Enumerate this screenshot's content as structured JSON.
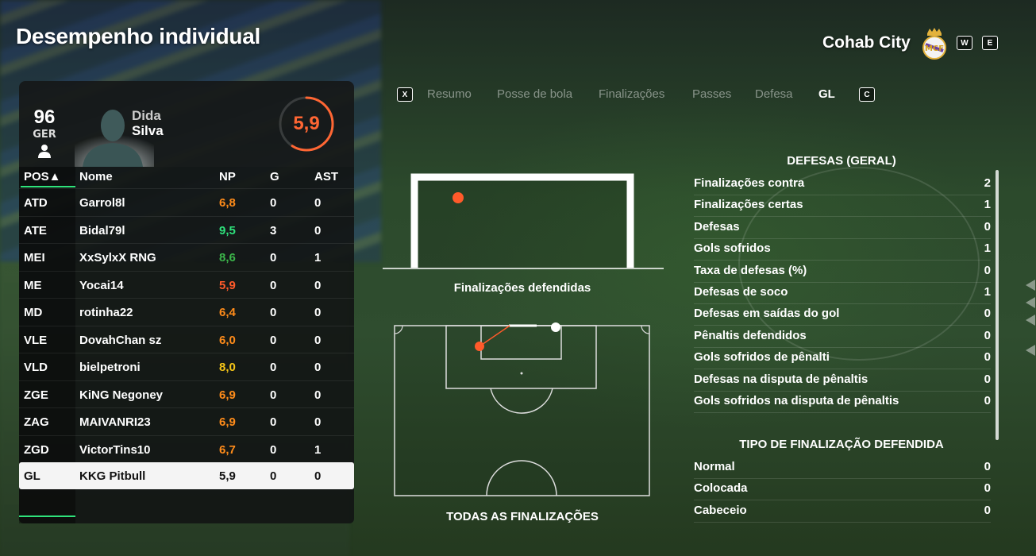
{
  "header": {
    "title": "Desempenho individual",
    "team_name": "Cohab City",
    "key_prev": "W",
    "key_next": "E"
  },
  "player": {
    "overall": "96",
    "position": "GER",
    "first_name": "Dida",
    "last_name": "Silva",
    "rating": "5,9",
    "rating_color": "#ff6633"
  },
  "table": {
    "headers": {
      "pos": "POS▲",
      "name": "Nome",
      "np": "NP",
      "g": "G",
      "ast": "AST"
    },
    "rows": [
      {
        "pos": "ATD",
        "name": "Garrol8l",
        "np": "6,8",
        "np_color": "#ff8c1a",
        "g": "0",
        "ast": "0"
      },
      {
        "pos": "ATE",
        "name": "Bidal79l",
        "np": "9,5",
        "np_color": "#2fe27b",
        "g": "3",
        "ast": "0"
      },
      {
        "pos": "MEI",
        "name": "XxSylxX RNG",
        "np": "8,6",
        "np_color": "#3cb54a",
        "g": "0",
        "ast": "1"
      },
      {
        "pos": "ME",
        "name": "Yocai14",
        "np": "5,9",
        "np_color": "#ff5a2a",
        "g": "0",
        "ast": "0"
      },
      {
        "pos": "MD",
        "name": "rotinha22",
        "np": "6,4",
        "np_color": "#ff8c1a",
        "g": "0",
        "ast": "0"
      },
      {
        "pos": "VLE",
        "name": "DovahChan sz",
        "np": "6,0",
        "np_color": "#ff8c1a",
        "g": "0",
        "ast": "0"
      },
      {
        "pos": "VLD",
        "name": "bielpetroni",
        "np": "8,0",
        "np_color": "#f5c518",
        "g": "0",
        "ast": "0"
      },
      {
        "pos": "ZGE",
        "name": "KiNG Negoney",
        "np": "6,9",
        "np_color": "#ff8c1a",
        "g": "0",
        "ast": "0"
      },
      {
        "pos": "ZAG",
        "name": "MAIVANRI23",
        "np": "6,9",
        "np_color": "#ff8c1a",
        "g": "0",
        "ast": "0"
      },
      {
        "pos": "ZGD",
        "name": "VictorTins10",
        "np": "6,7",
        "np_color": "#ff8c1a",
        "g": "0",
        "ast": "1"
      },
      {
        "pos": "GL",
        "name": "KKG Pitbull",
        "np": "5,9",
        "np_color": "#111111",
        "g": "0",
        "ast": "0"
      }
    ]
  },
  "tabs": {
    "key_left": "X",
    "key_right": "C",
    "items": [
      "Resumo",
      "Posse de bola",
      "Finalizações",
      "Passes",
      "Defesa",
      "GL"
    ],
    "active": "GL"
  },
  "goal_graphic": {
    "label_saved": "Finalizações defendidas",
    "label_all": "TODAS AS FINALIZAÇÕES"
  },
  "stats": {
    "section1_title": "DEFESAS (GERAL)",
    "section1": [
      {
        "label": "Finalizações contra",
        "value": "2"
      },
      {
        "label": "Finalizações certas",
        "value": "1"
      },
      {
        "label": "Defesas",
        "value": "0"
      },
      {
        "label": "Gols sofridos",
        "value": "1"
      },
      {
        "label": "Taxa de defesas (%)",
        "value": "0"
      },
      {
        "label": "Defesas de soco",
        "value": "1"
      },
      {
        "label": "Defesas em saídas do gol",
        "value": "0"
      },
      {
        "label": "Pênaltis defendidos",
        "value": "0"
      },
      {
        "label": "Gols sofridos de pênalti",
        "value": "0"
      },
      {
        "label": "Defesas na disputa de pênaltis",
        "value": "0"
      },
      {
        "label": "Gols sofridos na disputa de pênaltis",
        "value": "0"
      }
    ],
    "section2_title": "TIPO DE FINALIZAÇÃO DEFENDIDA",
    "section2": [
      {
        "label": "Normal",
        "value": "0"
      },
      {
        "label": "Colocada",
        "value": "0"
      },
      {
        "label": "Cabeceio",
        "value": "0"
      }
    ]
  }
}
